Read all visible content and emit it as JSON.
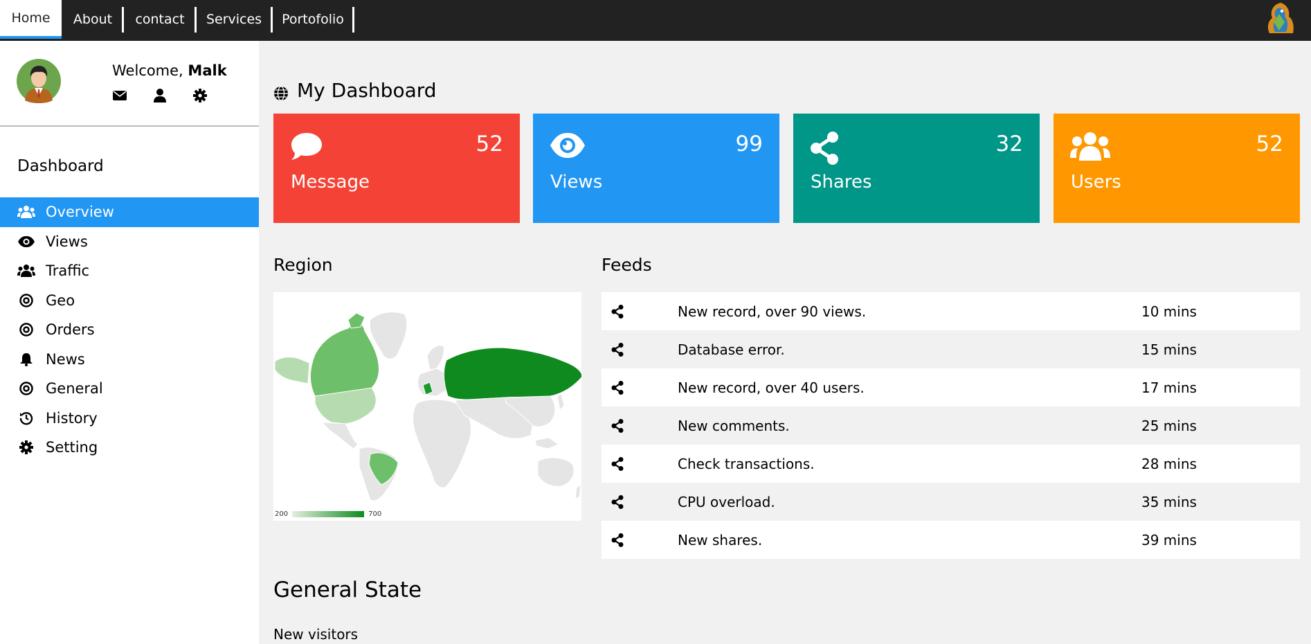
{
  "nav": {
    "items": [
      {
        "label": "Home"
      },
      {
        "label": "About"
      },
      {
        "label": "contact"
      },
      {
        "label": "Services"
      },
      {
        "label": "Portofolio"
      }
    ]
  },
  "profile": {
    "welcome_prefix": "Welcome, ",
    "name": "Malk"
  },
  "sidebar": {
    "heading": "Dashboard",
    "items": [
      {
        "label": "Overview",
        "icon": "users-icon"
      },
      {
        "label": "Views",
        "icon": "eye-icon"
      },
      {
        "label": "Traffic",
        "icon": "users-icon"
      },
      {
        "label": "Geo",
        "icon": "target-icon"
      },
      {
        "label": "Orders",
        "icon": "target-icon"
      },
      {
        "label": "News",
        "icon": "bell-icon"
      },
      {
        "label": "General",
        "icon": "target-icon"
      },
      {
        "label": "History",
        "icon": "history-icon"
      },
      {
        "label": "Setting",
        "icon": "gear-icon"
      }
    ]
  },
  "main": {
    "title": "My Dashboard",
    "cards": [
      {
        "label": "Message",
        "value": "52",
        "icon": "comment-icon",
        "color": "#f44336"
      },
      {
        "label": "Views",
        "value": "99",
        "icon": "eye-icon",
        "color": "#2196f3"
      },
      {
        "label": "Shares",
        "value": "32",
        "icon": "share-icon",
        "color": "#009688"
      },
      {
        "label": "Users",
        "value": "52",
        "icon": "users-icon",
        "color": "#ff9800"
      }
    ],
    "region": {
      "title": "Region",
      "legend_min": "200",
      "legend_max": "700"
    },
    "feeds": {
      "title": "Feeds",
      "rows": [
        {
          "text": "New record, over 90 views.",
          "time": "10 mins"
        },
        {
          "text": "Database error.",
          "time": "15 mins"
        },
        {
          "text": "New record, over 40 users.",
          "time": "17 mins"
        },
        {
          "text": "New comments.",
          "time": "25 mins"
        },
        {
          "text": "Check transactions.",
          "time": "28 mins"
        },
        {
          "text": "CPU overload.",
          "time": "35 mins"
        },
        {
          "text": "New shares.",
          "time": "39 mins"
        }
      ]
    },
    "general_state": {
      "title": "General State",
      "first_label": "New visitors"
    }
  },
  "colors": {
    "active_blue": "#2196f3",
    "topbar": "#222222"
  }
}
